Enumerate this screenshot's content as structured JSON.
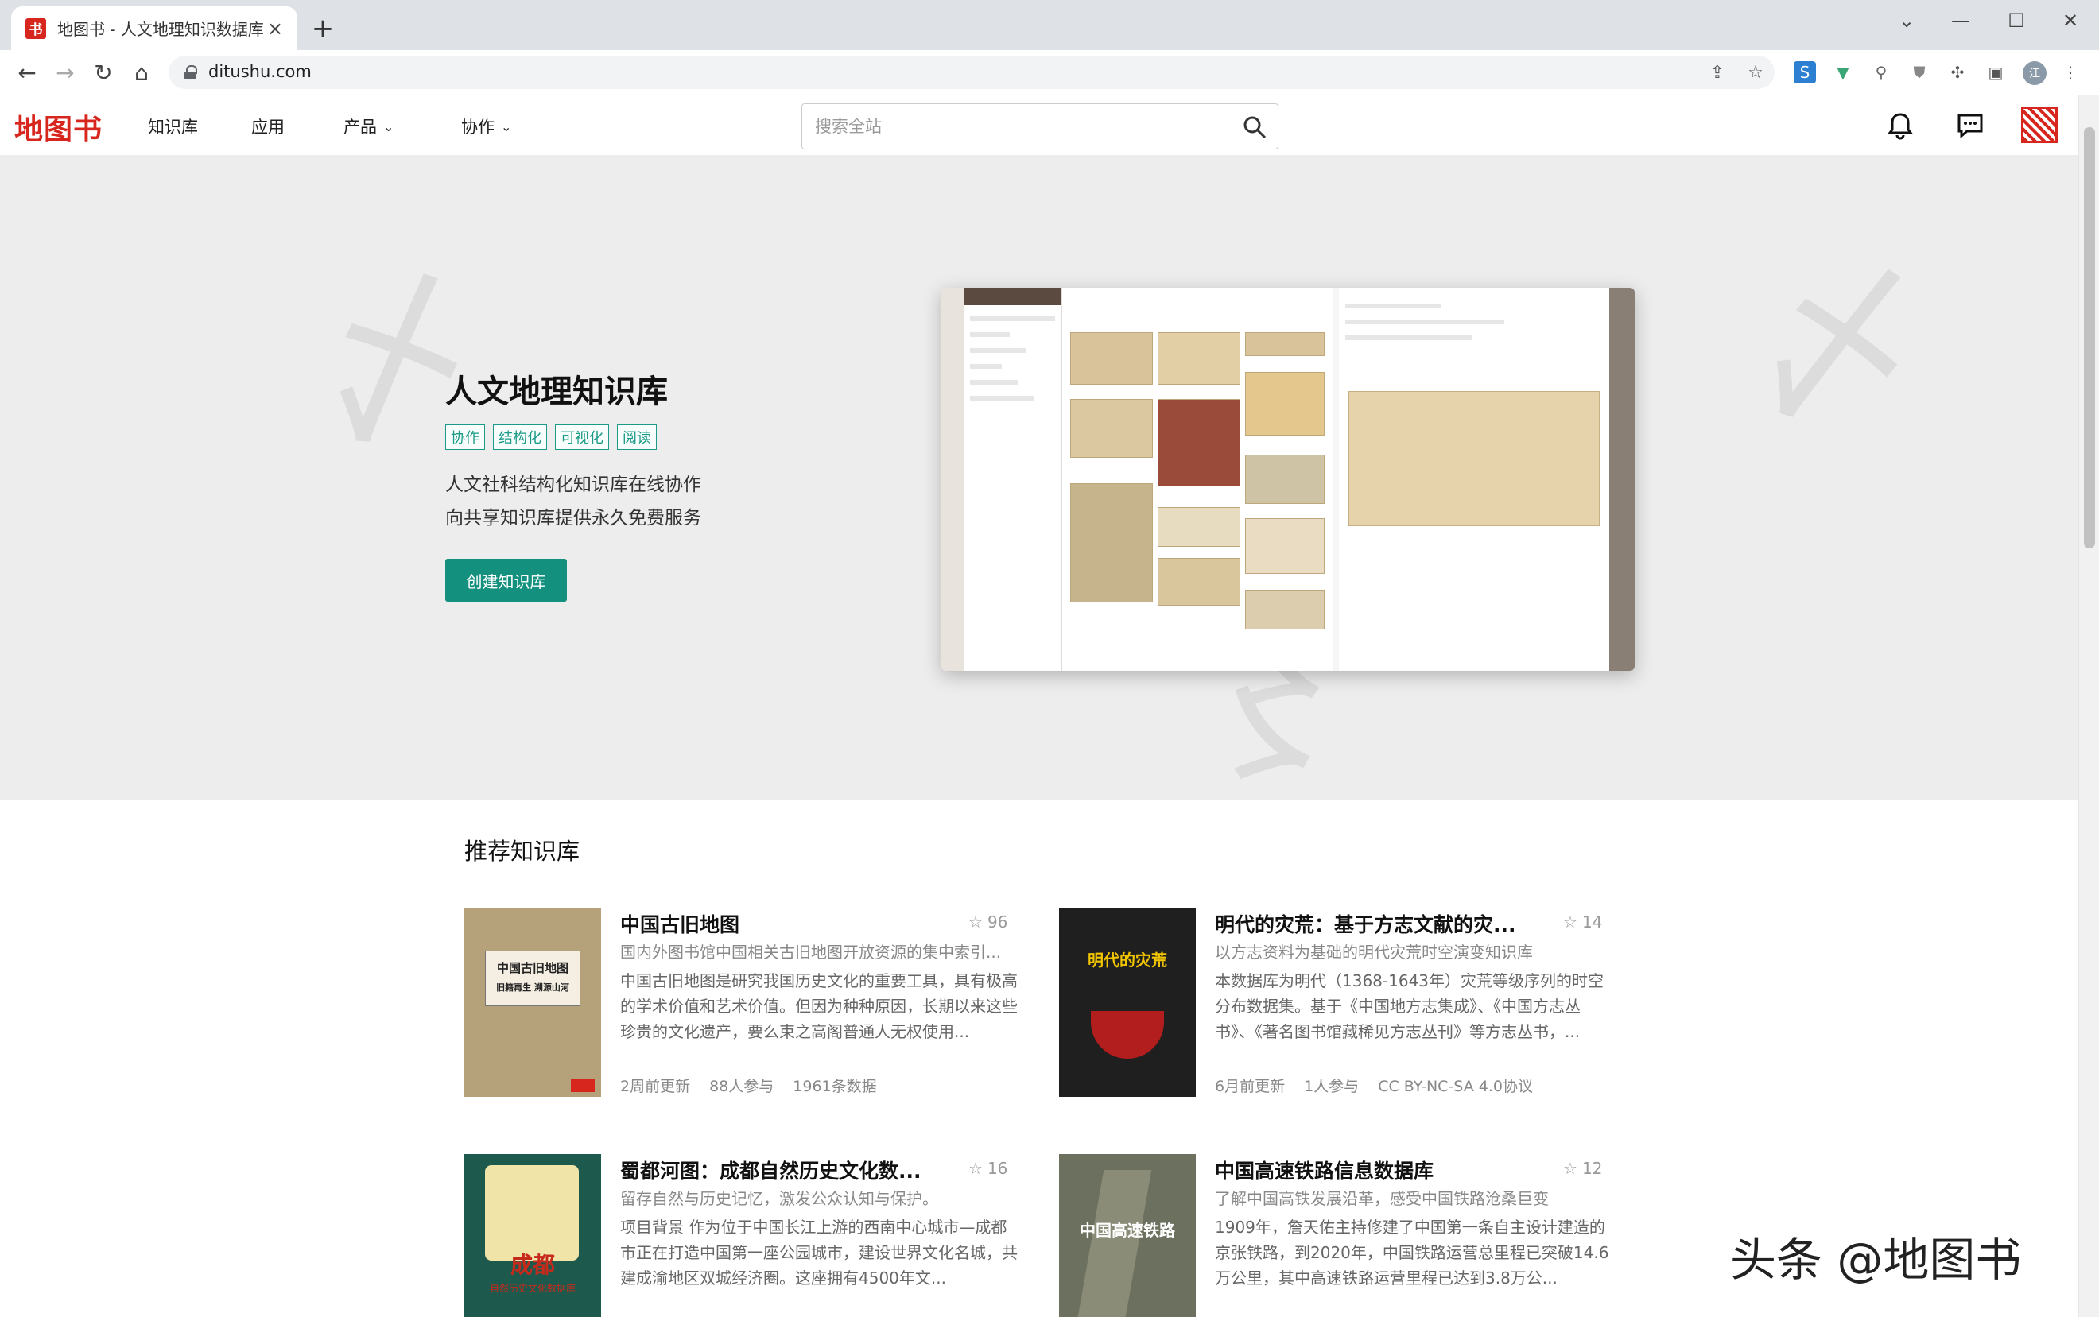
{
  "browser": {
    "tab_title": "地图书 - 人文地理知识数据库",
    "url": "ditushu.com",
    "profile_initial": "江",
    "tab_favicon_text": "书"
  },
  "site": {
    "logo": "地图书",
    "nav": [
      {
        "label": "知识库",
        "has_dropdown": false
      },
      {
        "label": "应用",
        "has_dropdown": false
      },
      {
        "label": "产品",
        "has_dropdown": true
      },
      {
        "label": "协作",
        "has_dropdown": true
      }
    ],
    "search_placeholder": "搜索全站",
    "accent_color": "#d7261e"
  },
  "hero": {
    "title": "人文地理知识库",
    "tags": [
      "协作",
      "结构化",
      "可视化",
      "阅读"
    ],
    "desc_line1": "人文社科结构化知识库在线协作",
    "desc_line2": "向共享知识库提供永久免费服务",
    "button_label": "创建知识库",
    "button_color": "#13907e"
  },
  "recommended": {
    "heading": "推荐知识库",
    "cards": [
      {
        "title": "中国古旧地图",
        "stars": "96",
        "subtitle": "国内外图书馆中国相关古旧地图开放资源的集中索引...",
        "body": "中国古旧地图是研究我国历史文化的重要工具，具有极高的学术价值和艺术价值。但因为种种原因，长期以来这些珍贵的文化遗产，要么束之高阁普通人无权使用...",
        "meta": [
          "2周前更新",
          "88人参与",
          "1961条数据"
        ],
        "cover_text": "中国古旧地图",
        "cover_sub": "旧籍再生 溯源山河"
      },
      {
        "title": "明代的灾荒：基于方志文献的灾...",
        "stars": "14",
        "subtitle": "以方志资料为基础的明代灾荒时空演变知识库",
        "body": "本数据库为明代（1368-1643年）灾荒等级序列的时空分布数据集。基于《中国地方志集成》、《中国方志丛书》、《著名图书馆藏稀见方志丛刊》等方志丛书，...",
        "meta": [
          "6月前更新",
          "1人参与",
          "CC BY-NC-SA 4.0协议"
        ],
        "cover_text": "明代的灾荒"
      },
      {
        "title": "蜀都河图：成都自然历史文化数...",
        "stars": "16",
        "subtitle": "留存自然与历史记忆，激发公众认知与保护。",
        "body": "项目背景 作为位于中国长江上游的西南中心城市—成都市正在打造中国第一座公园城市，建设世界文化名城，共建成渝地区双城经济圈。这座拥有4500年文...",
        "meta": [],
        "cover_text": "成都",
        "cover_sub": "自然历史文化数据库"
      },
      {
        "title": "中国高速铁路信息数据库",
        "stars": "12",
        "subtitle": "了解中国高铁发展沿革，感受中国铁路沧桑巨变",
        "body": "1909年，詹天佑主持修建了中国第一条自主设计建造的京张铁路，到2020年，中国铁路运营总里程已突破14.6万公里，其中高速铁路运营里程已达到3.8万公...",
        "meta": [],
        "cover_text": "中国高速铁路"
      }
    ]
  },
  "watermark": "头条 @地图书"
}
